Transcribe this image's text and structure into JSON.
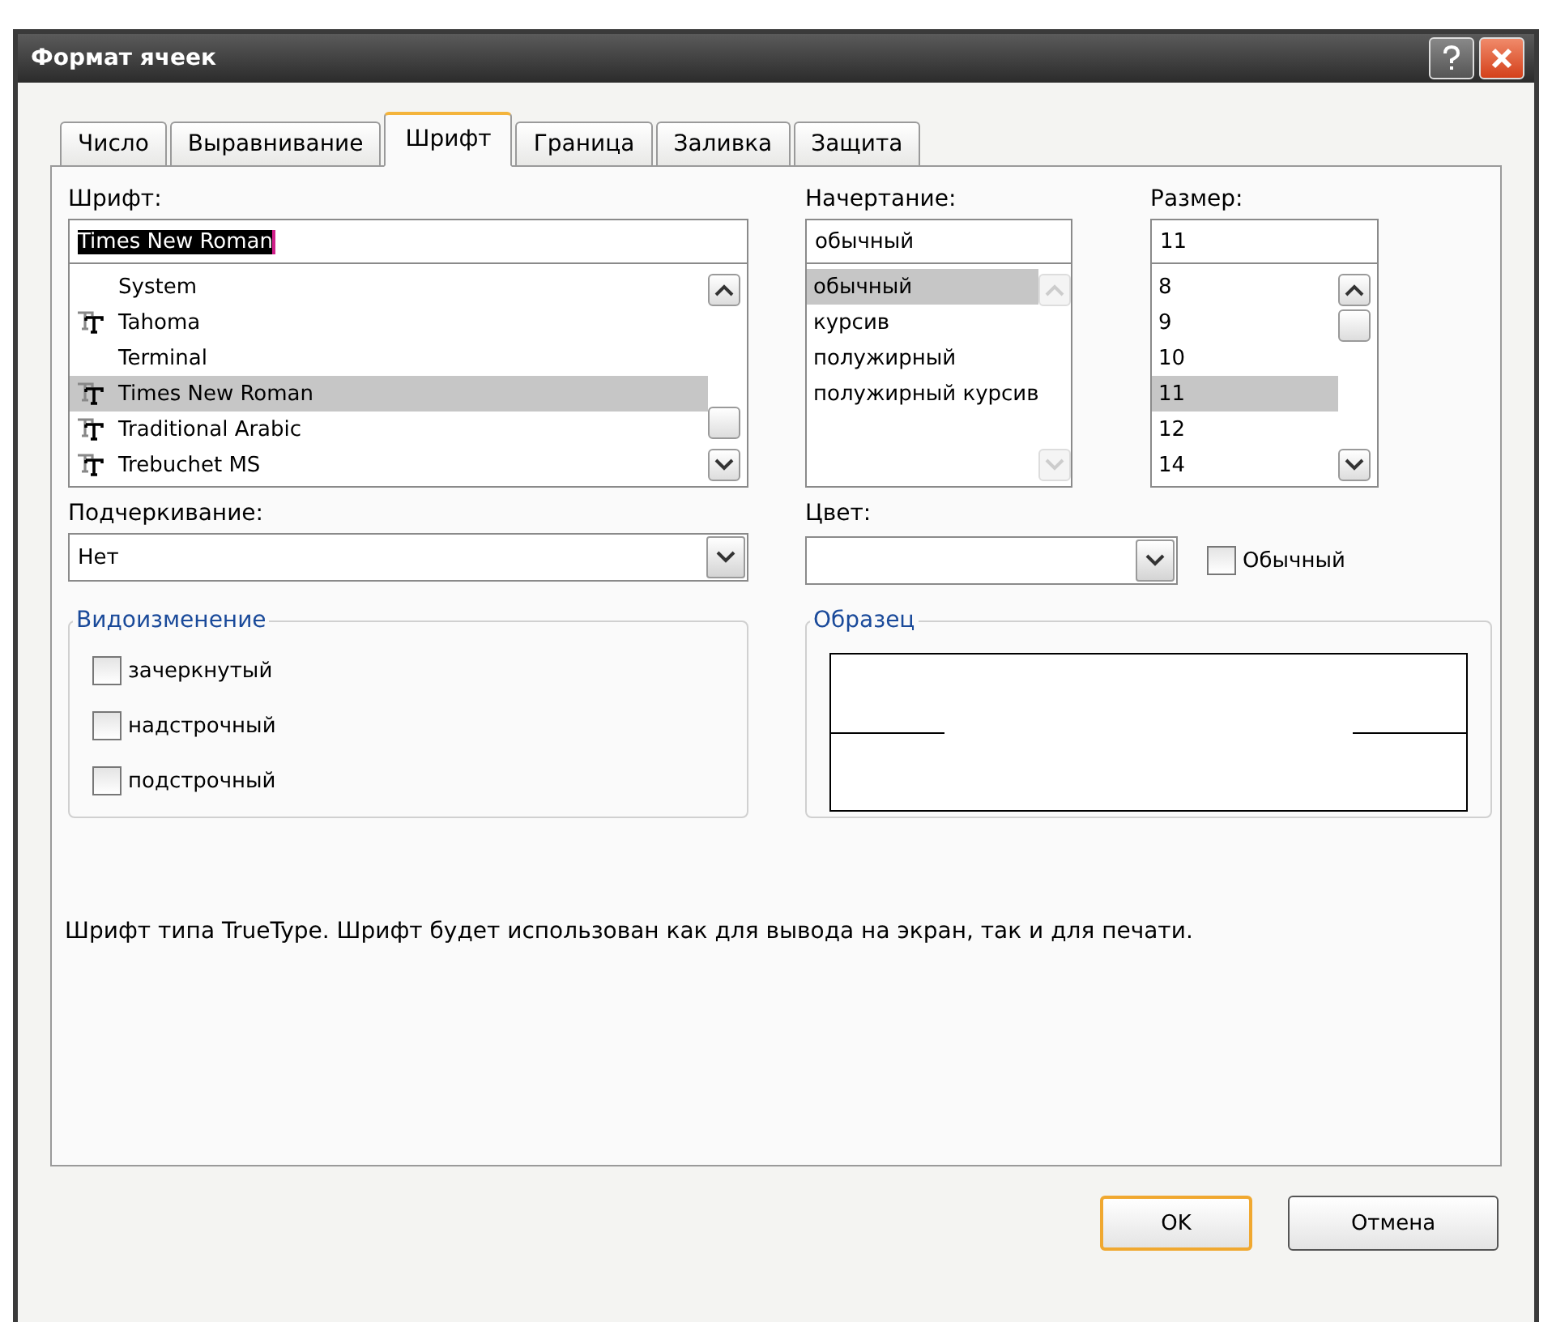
{
  "window": {
    "title": "Формат ячеек"
  },
  "tabs": [
    {
      "label": "Число",
      "selected": false
    },
    {
      "label": "Выравнивание",
      "selected": false
    },
    {
      "label": "Шрифт",
      "selected": true
    },
    {
      "label": "Граница",
      "selected": false
    },
    {
      "label": "Заливка",
      "selected": false
    },
    {
      "label": "Защита",
      "selected": false
    }
  ],
  "font": {
    "label": "Шрифт:",
    "value": "Times New Roman",
    "items": [
      {
        "name": "System",
        "truetype": false,
        "selected": false
      },
      {
        "name": "Tahoma",
        "truetype": true,
        "selected": false
      },
      {
        "name": "Terminal",
        "truetype": false,
        "selected": false
      },
      {
        "name": "Times New Roman",
        "truetype": true,
        "selected": true
      },
      {
        "name": "Traditional Arabic",
        "truetype": true,
        "selected": false
      },
      {
        "name": "Trebuchet MS",
        "truetype": true,
        "selected": false
      }
    ]
  },
  "style": {
    "label": "Начертание:",
    "value": "обычный",
    "items": [
      {
        "name": "обычный",
        "selected": true
      },
      {
        "name": "курсив",
        "selected": false
      },
      {
        "name": "полужирный",
        "selected": false
      },
      {
        "name": "полужирный курсив",
        "selected": false
      }
    ]
  },
  "size": {
    "label": "Размер:",
    "value": "11",
    "items": [
      {
        "name": "8",
        "selected": false
      },
      {
        "name": "9",
        "selected": false
      },
      {
        "name": "10",
        "selected": false
      },
      {
        "name": "11",
        "selected": true
      },
      {
        "name": "12",
        "selected": false
      },
      {
        "name": "14",
        "selected": false
      }
    ]
  },
  "underline": {
    "label": "Подчеркивание:",
    "value": "Нет"
  },
  "color": {
    "label": "Цвет:",
    "normal_checkbox": {
      "label": "Обычный",
      "checked": false
    }
  },
  "effects": {
    "title": "Видоизменение",
    "items": [
      {
        "label": "зачеркнутый",
        "checked": false
      },
      {
        "label": "надстрочный",
        "checked": false
      },
      {
        "label": "подстрочный",
        "checked": false
      }
    ]
  },
  "preview": {
    "title": "Образец"
  },
  "description": "Шрифт типа TrueType. Шрифт будет использован как для вывода на экран, так и для печати.",
  "buttons": [
    {
      "label": "OK",
      "default": true
    },
    {
      "label": "Отмена",
      "default": false
    }
  ]
}
